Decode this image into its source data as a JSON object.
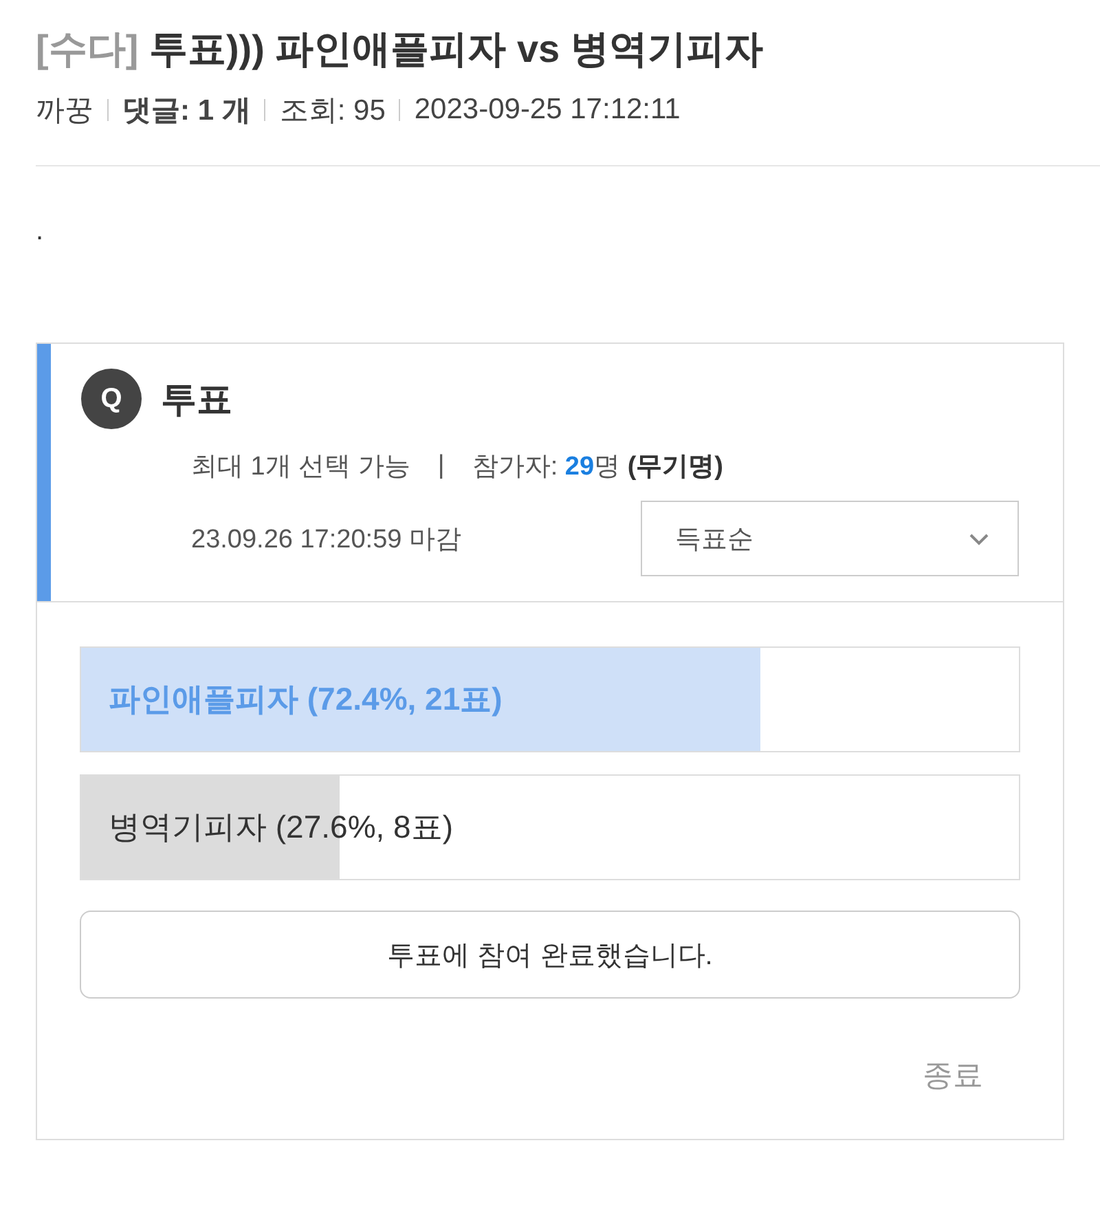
{
  "post": {
    "category": "[수다]",
    "title": "투표))) 파인애플피자 vs 병역기피자",
    "meta": [
      {
        "text": "까꿍",
        "bold": false
      },
      {
        "text": "댓글: 1 개",
        "bold": true
      },
      {
        "text": "조회: 95",
        "bold": false
      },
      {
        "text": "2023-09-25 17:12:11",
        "bold": false
      }
    ],
    "body": "."
  },
  "poll": {
    "badge": "Q",
    "title": "투표",
    "limit": "최대 1개 선택 가능",
    "separator": "|",
    "participants": {
      "label": "참가자:",
      "count": "29",
      "unit": "명",
      "note": "(무기명)"
    },
    "deadline": "23.09.26 17:20:59 마감",
    "sort": {
      "value": "득표순"
    },
    "options": [
      {
        "label": "파인애플피자 (72.4%, 21표)",
        "level": 0.724,
        "selected": true
      },
      {
        "label": "병역기피자 (27.6%, 8표)",
        "level": 0.276,
        "selected": false
      }
    ],
    "status_button": "투표에 참여 완료했습니다.",
    "close_button": "종료"
  }
}
